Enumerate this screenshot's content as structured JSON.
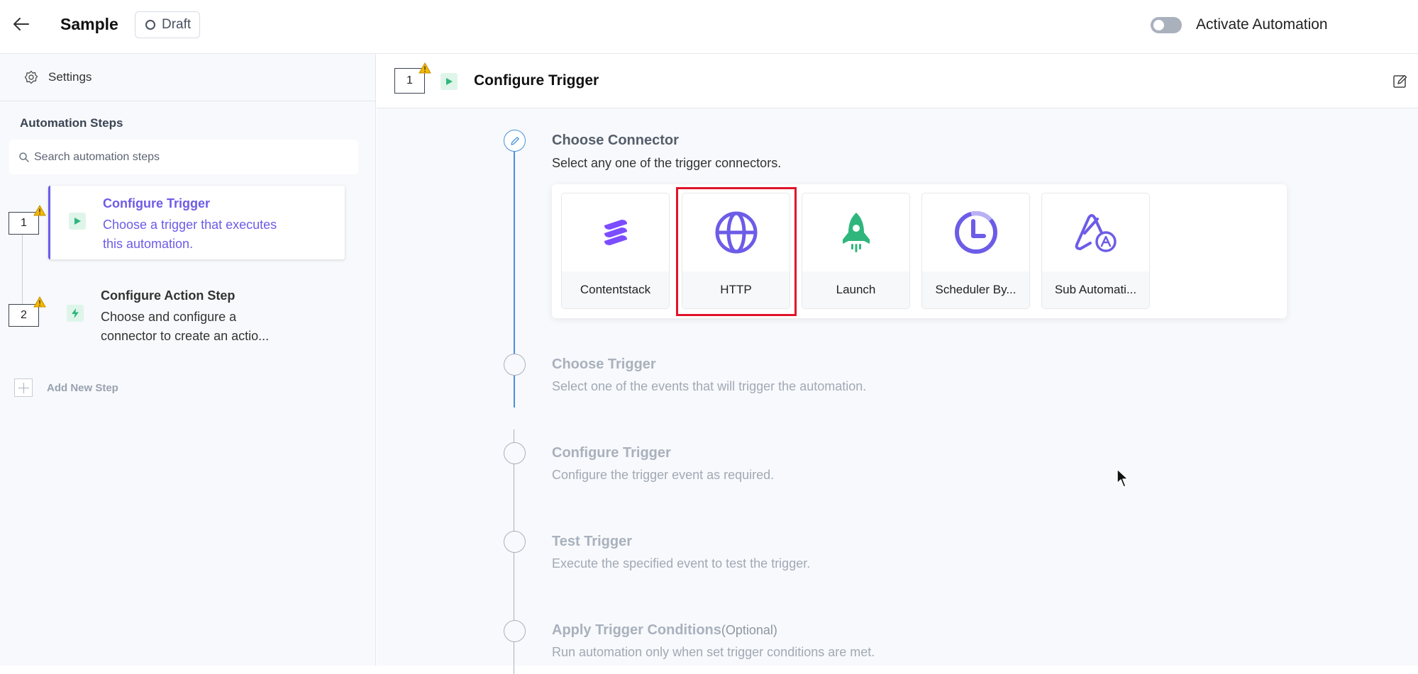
{
  "header": {
    "title": "Sample",
    "status": "Draft",
    "activate_label": "Activate Automation",
    "activate_enabled": false
  },
  "sidebar": {
    "settings_label": "Settings",
    "steps_heading": "Automation Steps",
    "search_placeholder": "Search automation steps",
    "steps": [
      {
        "number": "1",
        "title": "Configure Trigger",
        "description": "Choose a trigger that executes this automation.",
        "warning": true,
        "selected": true
      },
      {
        "number": "2",
        "title": "Configure Action Step",
        "description": "Choose and configure a connector to create an actio...",
        "warning": true,
        "selected": false
      }
    ],
    "add_step_label": "Add New Step"
  },
  "main": {
    "step_number": "1",
    "title": "Configure Trigger",
    "sections": [
      {
        "title": "Choose Connector",
        "description": "Select any one of the trigger connectors.",
        "active": true
      },
      {
        "title": "Choose Trigger",
        "description": "Select one of the events that will trigger the automation.",
        "active": false
      },
      {
        "title": "Configure Trigger",
        "description": "Configure the trigger event as required.",
        "active": false
      },
      {
        "title": "Test Trigger",
        "description": "Execute the specified event to test the trigger.",
        "active": false
      },
      {
        "title": "Apply Trigger Conditions",
        "optional_label": "(Optional)",
        "description": "Run automation only when set trigger conditions are met.",
        "active": false
      }
    ],
    "connectors": [
      {
        "label": "Contentstack",
        "icon": "contentstack-icon"
      },
      {
        "label": "HTTP",
        "icon": "globe-icon",
        "highlighted": true
      },
      {
        "label": "Launch",
        "icon": "rocket-icon"
      },
      {
        "label": "Scheduler By...",
        "icon": "clock-icon"
      },
      {
        "label": "Sub Automati...",
        "icon": "sub-automation-icon"
      }
    ]
  },
  "colors": {
    "accent_purple": "#6c5ce7",
    "highlight_red": "#e0142b",
    "timeline_blue": "#4a90d9",
    "warning_yellow": "#f5b800",
    "play_green": "#2fb67c"
  }
}
